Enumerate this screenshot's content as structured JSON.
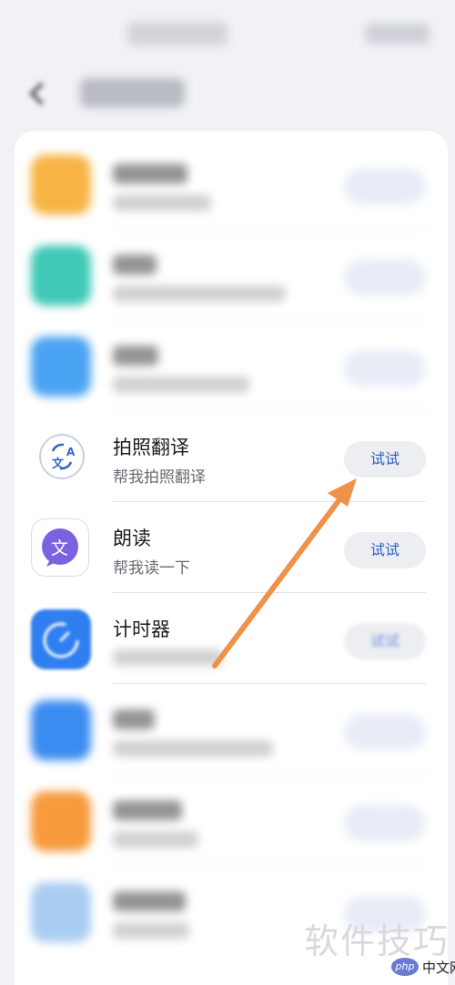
{
  "colors": {
    "background": "#f1f2f6",
    "card": "#ffffff",
    "try_button_text": "#2b5fc8",
    "arrow": "#f0914a"
  },
  "items": [
    {
      "title": "",
      "subtitle": "",
      "button": "",
      "icon": "yellow-app-icon",
      "blurred": true
    },
    {
      "title": "",
      "subtitle": "",
      "button": "",
      "icon": "teal-app-icon",
      "blurred": true
    },
    {
      "title": "",
      "subtitle": "",
      "button": "",
      "icon": "weather-app-icon",
      "blurred": true
    },
    {
      "title": "拍照翻译",
      "subtitle": "帮我拍照翻译",
      "button": "试试",
      "icon": "photo-translate-icon",
      "blurred": false
    },
    {
      "title": "朗读",
      "subtitle": "帮我读一下",
      "button": "试试",
      "icon": "read-aloud-icon",
      "blurred": false
    },
    {
      "title": "计时器",
      "subtitle": "",
      "button": "试试",
      "icon": "timer-icon",
      "blurred": false
    },
    {
      "title": "",
      "subtitle": "",
      "button": "",
      "icon": "blue-app-icon",
      "blurred": true
    },
    {
      "title": "",
      "subtitle": "",
      "button": "",
      "icon": "orange-app-icon",
      "blurred": true
    },
    {
      "title": "",
      "subtitle": "",
      "button": "",
      "icon": "lightblue-app-icon",
      "blurred": true
    }
  ],
  "icon_glyphs": {
    "photo_translate": "文",
    "photo_translate_corner": "A",
    "read_aloud": "文"
  },
  "watermark": {
    "main": "软件技巧",
    "php_logo": "php",
    "php_text": "中文网"
  }
}
